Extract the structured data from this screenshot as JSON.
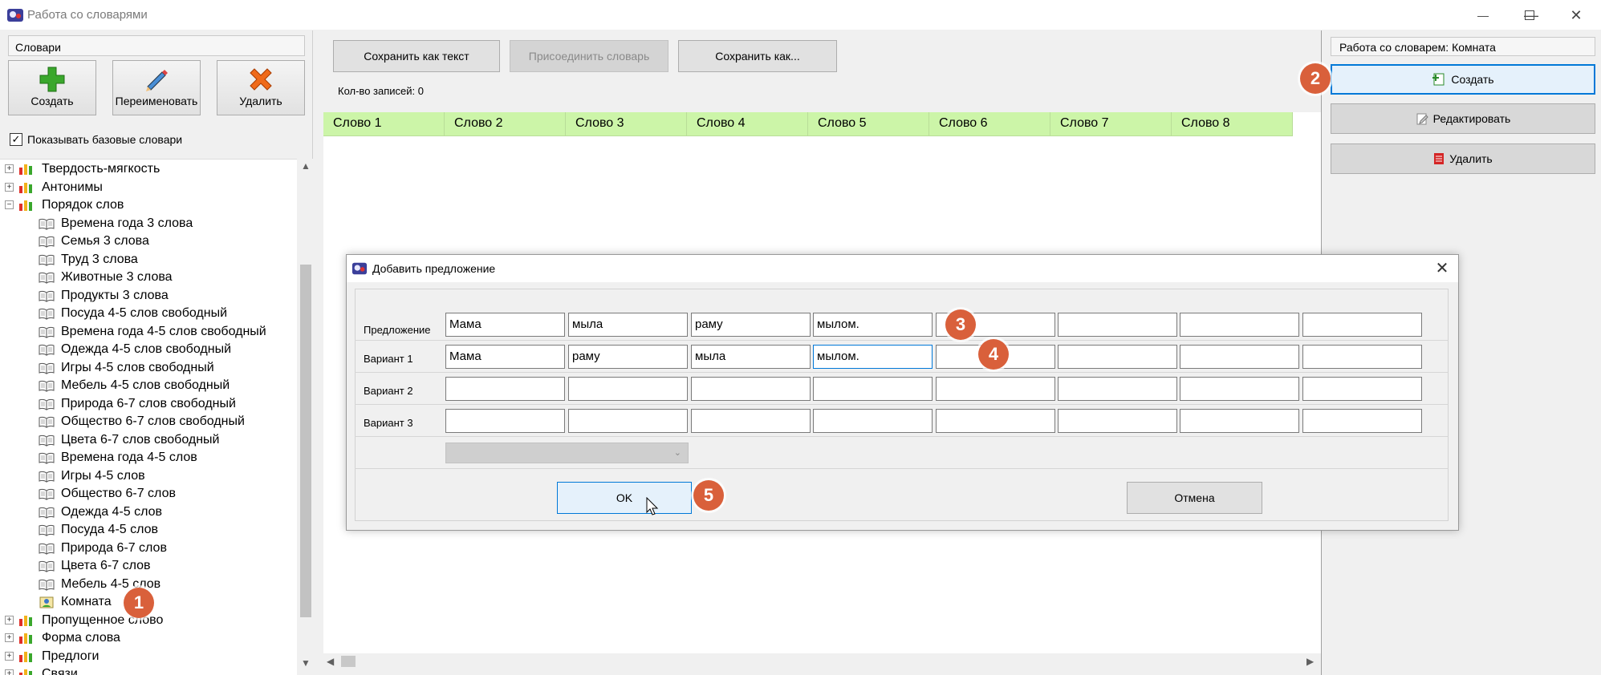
{
  "window": {
    "title": "Работа со словарями"
  },
  "left": {
    "header": "Словари",
    "buttons": {
      "create": "Создать",
      "rename": "Переименовать",
      "delete": "Удалить"
    },
    "show_base_label": "Показывать базовые словари",
    "show_base_checked": "✓",
    "tree": [
      {
        "label": "Твердость-мягкость",
        "level": 0
      },
      {
        "label": "Антонимы",
        "level": 0
      },
      {
        "label": "Порядок слов",
        "level": 0,
        "expanded": true
      },
      {
        "label": "Времена года 3 слова",
        "level": 1
      },
      {
        "label": "Семья 3 слова",
        "level": 1
      },
      {
        "label": "Труд 3 слова",
        "level": 1
      },
      {
        "label": "Животные 3 слова",
        "level": 1
      },
      {
        "label": "Продукты 3 слова",
        "level": 1
      },
      {
        "label": "Посуда 4-5 слов свободный",
        "level": 1
      },
      {
        "label": "Времена года 4-5 слов свободный",
        "level": 1
      },
      {
        "label": "Одежда 4-5 слов свободный",
        "level": 1
      },
      {
        "label": "Игры 4-5 слов свободный",
        "level": 1
      },
      {
        "label": "Мебель 4-5 слов свободный",
        "level": 1
      },
      {
        "label": "Природа 6-7 слов свободный",
        "level": 1
      },
      {
        "label": "Общество 6-7 слов свободный",
        "level": 1
      },
      {
        "label": "Цвета 6-7 слов свободный",
        "level": 1
      },
      {
        "label": "Времена года 4-5 слов",
        "level": 1
      },
      {
        "label": "Игры 4-5 слов",
        "level": 1
      },
      {
        "label": "Общество 6-7 слов",
        "level": 1
      },
      {
        "label": "Одежда 4-5 слов",
        "level": 1
      },
      {
        "label": "Посуда 4-5 слов",
        "level": 1
      },
      {
        "label": "Природа 6-7 слов",
        "level": 1
      },
      {
        "label": "Цвета 6-7 слов",
        "level": 1
      },
      {
        "label": "Мебель 4-5 слов",
        "level": 1
      },
      {
        "label": "Комната",
        "level": 1,
        "custom": true
      },
      {
        "label": "Пропущенное слово",
        "level": 0
      },
      {
        "label": "Форма слова",
        "level": 0
      },
      {
        "label": "Предлоги",
        "level": 0
      },
      {
        "label": "Связи",
        "level": 0
      }
    ]
  },
  "center": {
    "buttons": {
      "save_text": "Сохранить как текст",
      "attach": "Присоединить словарь",
      "save_as": "Сохранить как..."
    },
    "count_label": "Кол-во записей:",
    "count_value": "0",
    "columns": [
      "Слово 1",
      "Слово 2",
      "Слово 3",
      "Слово 4",
      "Слово 5",
      "Слово 6",
      "Слово 7",
      "Слово 8"
    ]
  },
  "right": {
    "header": "Работа со словарем: Комната",
    "buttons": {
      "create": "Создать",
      "edit": "Редактировать",
      "delete": "Удалить"
    }
  },
  "dialog": {
    "title": "Добавить предложение",
    "rows": [
      {
        "label": "Предложение",
        "cells": [
          "Мама",
          "мыла",
          "раму",
          "мылом.",
          "",
          "",
          "",
          ""
        ]
      },
      {
        "label": "Вариант 1",
        "cells": [
          "Мама",
          "раму",
          "мыла",
          "мылом.",
          "",
          "",
          "",
          ""
        ]
      },
      {
        "label": "Вариант 2",
        "cells": [
          "",
          "",
          "",
          "",
          "",
          "",
          "",
          ""
        ]
      },
      {
        "label": "Вариант 3",
        "cells": [
          "",
          "",
          "",
          "",
          "",
          "",
          "",
          ""
        ]
      }
    ],
    "ok": "OK",
    "cancel": "Отмена"
  },
  "markers": [
    "1",
    "2",
    "3",
    "4",
    "5"
  ],
  "colors": {
    "accent": "#0078d7",
    "header_green": "#ccf5a8",
    "marker": "#d9603b"
  }
}
